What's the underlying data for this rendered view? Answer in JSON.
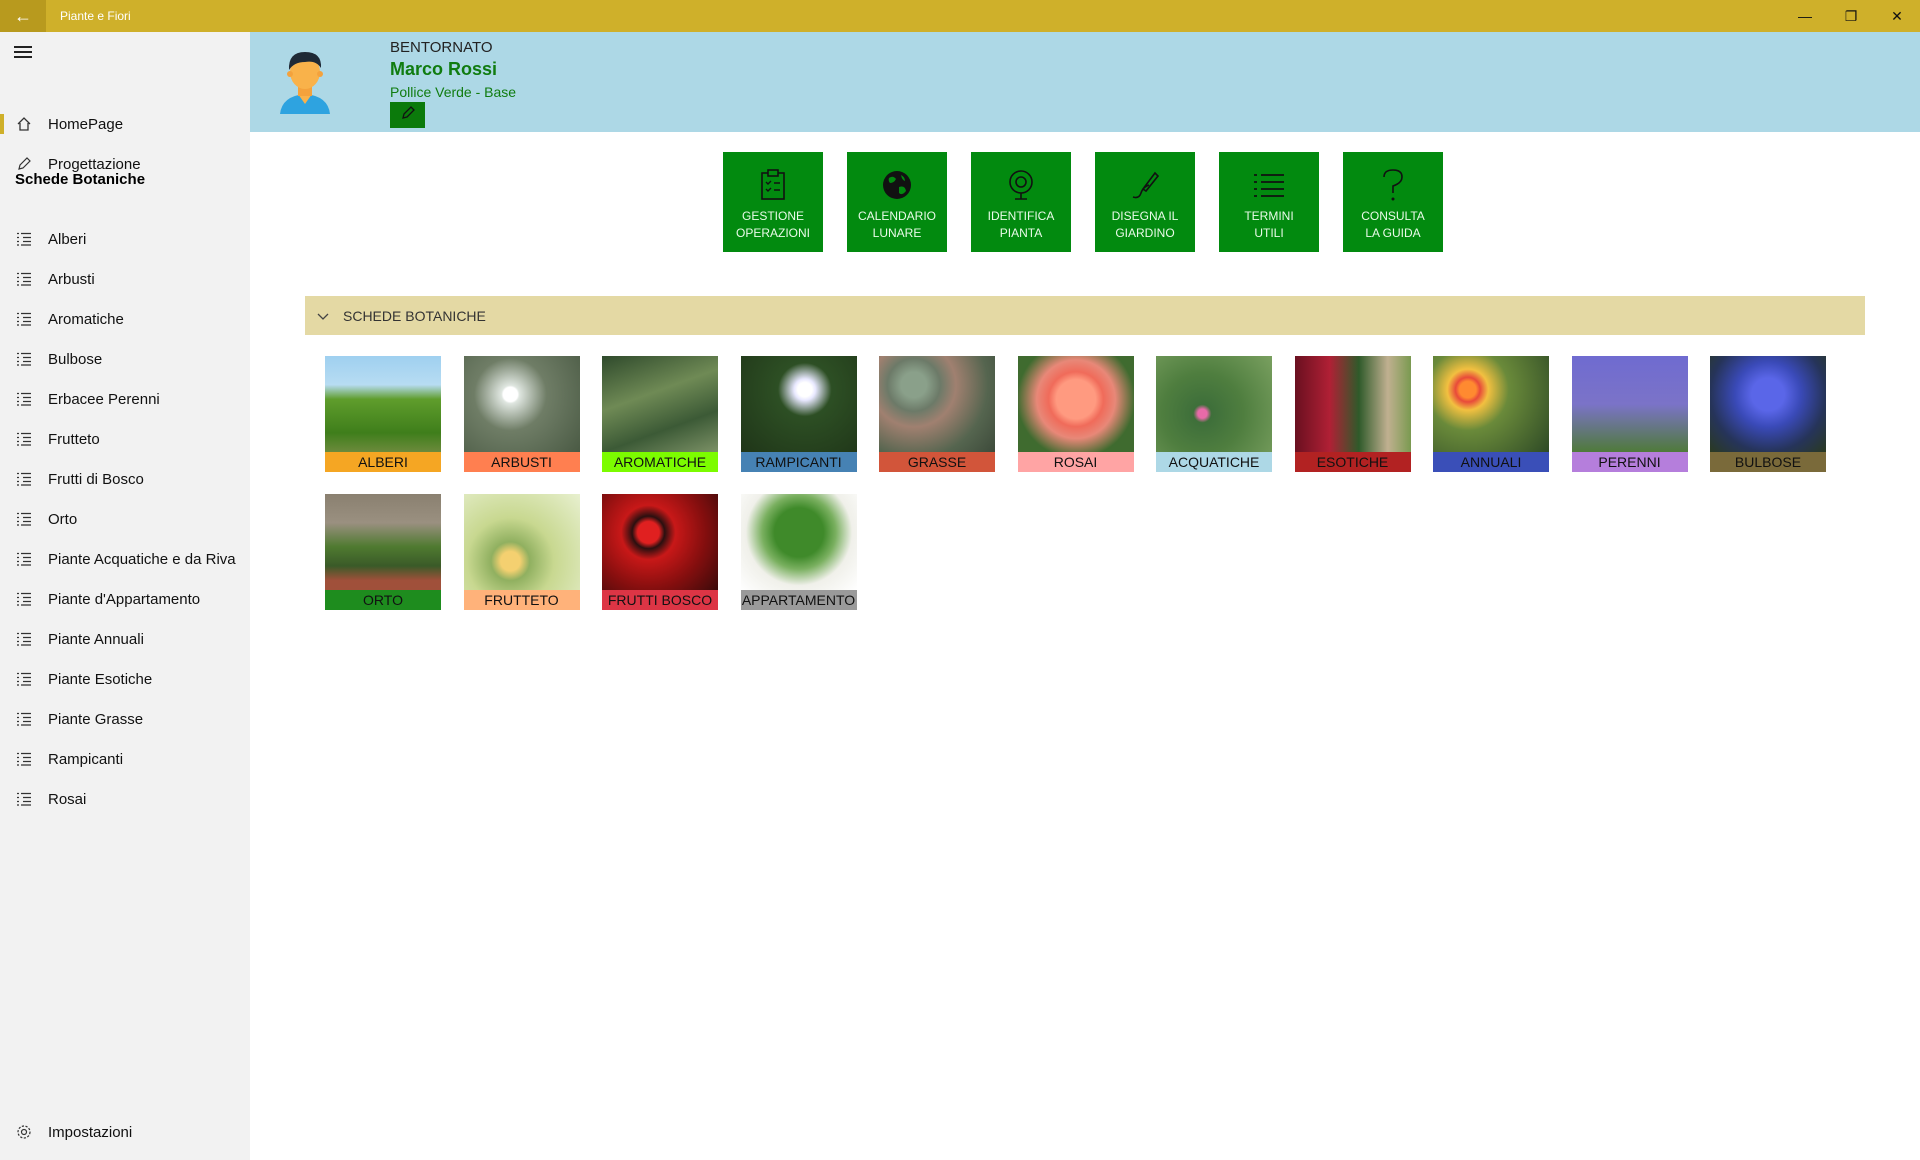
{
  "window": {
    "title": "Piante e Fiori"
  },
  "sidebar": {
    "top_items": [
      {
        "label": "HomePage"
      },
      {
        "label": "Progettazione"
      }
    ],
    "section_header": "Schede Botaniche",
    "items": [
      {
        "label": "Alberi"
      },
      {
        "label": "Arbusti"
      },
      {
        "label": "Aromatiche"
      },
      {
        "label": "Bulbose"
      },
      {
        "label": "Erbacee Perenni"
      },
      {
        "label": "Frutteto"
      },
      {
        "label": "Frutti di Bosco"
      },
      {
        "label": "Orto"
      },
      {
        "label": "Piante Acquatiche e da Riva"
      },
      {
        "label": "Piante d'Appartamento"
      },
      {
        "label": "Piante Annuali"
      },
      {
        "label": "Piante Esotiche"
      },
      {
        "label": "Piante Grasse"
      },
      {
        "label": "Rampicanti"
      },
      {
        "label": "Rosai"
      }
    ],
    "settings_label": "Impostazioni"
  },
  "header": {
    "welcome": "BENTORNATO",
    "user_name": "Marco Rossi",
    "level": "Pollice Verde - Base"
  },
  "actions": [
    {
      "label_line1": "GESTIONE",
      "label_line2": "OPERAZIONI",
      "icon": "clipboard-icon"
    },
    {
      "label_line1": "CALENDARIO",
      "label_line2": "LUNARE",
      "icon": "globe-icon"
    },
    {
      "label_line1": "IDENTIFICA",
      "label_line2": "PIANTA",
      "icon": "webcam-icon"
    },
    {
      "label_line1": "DISEGNA IL",
      "label_line2": "GIARDINO",
      "icon": "pen-icon"
    },
    {
      "label_line1": "TERMINI",
      "label_line2": "UTILI",
      "icon": "list-icon"
    },
    {
      "label_line1": "CONSULTA",
      "label_line2": "LA GUIDA",
      "icon": "help-icon"
    }
  ],
  "section": {
    "title": "SCHEDE BOTANICHE"
  },
  "categories": [
    {
      "label": "ALBERI",
      "color": "#F5A623"
    },
    {
      "label": "ARBUSTI",
      "color": "#FF7F50"
    },
    {
      "label": "AROMATICHE",
      "color": "#7CFC00"
    },
    {
      "label": "RAMPICANTI",
      "color": "#4682B4"
    },
    {
      "label": "GRASSE",
      "color": "#D2553A"
    },
    {
      "label": "ROSAI",
      "color": "#FFA4A4"
    },
    {
      "label": "ACQUATICHE",
      "color": "#ADD8E6"
    },
    {
      "label": "ESOTICHE",
      "color": "#B22222"
    },
    {
      "label": "ANNUALI",
      "color": "#3A4FB8"
    },
    {
      "label": "PERENNI",
      "color": "#B57EDC"
    },
    {
      "label": "BULBOSE",
      "color": "#7A6A3A"
    },
    {
      "label": "ORTO",
      "color": "#1E8C1E"
    },
    {
      "label": "FRUTTETO",
      "color": "#FFB27A"
    },
    {
      "label": "FRUTTI BOSCO",
      "color": "#DC3545"
    },
    {
      "label": "APPARTAMENTO",
      "color": "#9A9A9A"
    }
  ]
}
